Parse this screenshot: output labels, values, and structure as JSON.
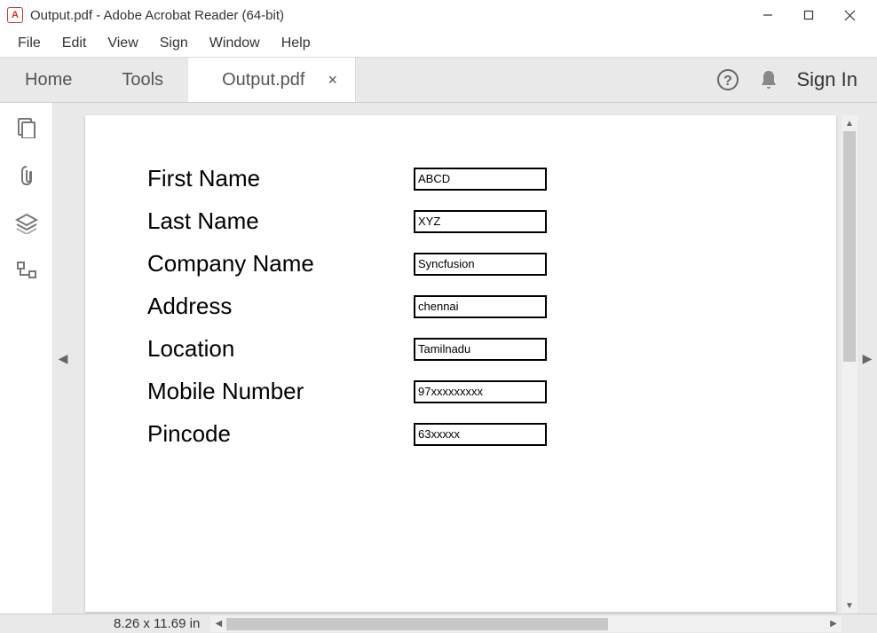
{
  "titlebar": {
    "title": "Output.pdf - Adobe Acrobat Reader (64-bit)"
  },
  "menubar": {
    "items": [
      "File",
      "Edit",
      "View",
      "Sign",
      "Window",
      "Help"
    ]
  },
  "toolbar": {
    "home": "Home",
    "tools": "Tools",
    "doc_tab": "Output.pdf",
    "signin": "Sign In"
  },
  "form": {
    "rows": [
      {
        "label": "First Name",
        "value": "ABCD"
      },
      {
        "label": "Last Name",
        "value": "XYZ"
      },
      {
        "label": "Company Name",
        "value": "Syncfusion"
      },
      {
        "label": "Address",
        "value": "chennai"
      },
      {
        "label": "Location",
        "value": "Tamilnadu"
      },
      {
        "label": "Mobile Number",
        "value": "97xxxxxxxxx"
      },
      {
        "label": "Pincode",
        "value": "63xxxxx"
      }
    ]
  },
  "statusbar": {
    "page_dimensions": "8.26 x 11.69 in"
  }
}
